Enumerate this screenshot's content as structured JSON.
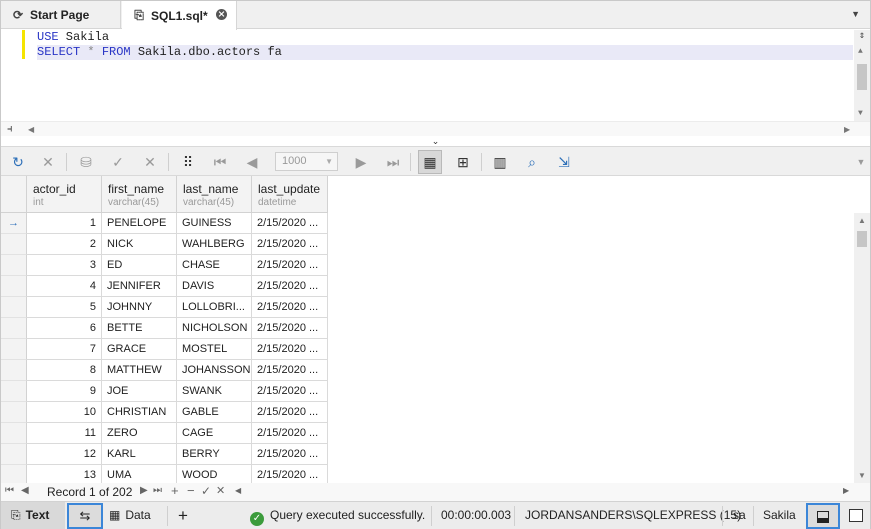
{
  "tabs": [
    {
      "label": "Start Page",
      "icon": "start-page-icon"
    },
    {
      "label": "SQL1.sql*",
      "icon": "sql-file-icon",
      "close": "⨯"
    }
  ],
  "editor": {
    "line1": {
      "kw": "USE",
      "rest": " Sakila"
    },
    "line2": {
      "kw1": "SELECT",
      "op": " * ",
      "kw2": "FROM",
      "rest": " Sakila.dbo.actors fa"
    }
  },
  "toolbar": {
    "page_size": "1000"
  },
  "grid": {
    "columns": [
      {
        "name": "actor_id",
        "type": "int"
      },
      {
        "name": "first_name",
        "type": "varchar(45)"
      },
      {
        "name": "last_name",
        "type": "varchar(45)"
      },
      {
        "name": "last_update",
        "type": "datetime"
      }
    ],
    "rows": [
      [
        "1",
        "PENELOPE",
        "GUINESS",
        "2/15/2020 ..."
      ],
      [
        "2",
        "NICK",
        "WAHLBERG",
        "2/15/2020 ..."
      ],
      [
        "3",
        "ED",
        "CHASE",
        "2/15/2020 ..."
      ],
      [
        "4",
        "JENNIFER",
        "DAVIS",
        "2/15/2020 ..."
      ],
      [
        "5",
        "JOHNNY",
        "LOLLOBRI...",
        "2/15/2020 ..."
      ],
      [
        "6",
        "BETTE",
        "NICHOLSON",
        "2/15/2020 ..."
      ],
      [
        "7",
        "GRACE",
        "MOSTEL",
        "2/15/2020 ..."
      ],
      [
        "8",
        "MATTHEW",
        "JOHANSSON",
        "2/15/2020 ..."
      ],
      [
        "9",
        "JOE",
        "SWANK",
        "2/15/2020 ..."
      ],
      [
        "10",
        "CHRISTIAN",
        "GABLE",
        "2/15/2020 ..."
      ],
      [
        "11",
        "ZERO",
        "CAGE",
        "2/15/2020 ..."
      ],
      [
        "12",
        "KARL",
        "BERRY",
        "2/15/2020 ..."
      ],
      [
        "13",
        "UMA",
        "WOOD",
        "2/15/2020 ..."
      ]
    ]
  },
  "navigator": {
    "record": "Record 1 of 202"
  },
  "status": {
    "text_label": "Text",
    "data_label": "Data",
    "add_label": "+",
    "message": "Query executed successfully.",
    "elapsed": "00:00:00.003",
    "server": "JORDANSANDERS\\SQLEXPRESS (15)",
    "user": "sa",
    "database": "Sakila"
  },
  "colors": {
    "accent": "#3b86d8",
    "success": "#3b9b3b",
    "keyword": "#2a36c6"
  }
}
